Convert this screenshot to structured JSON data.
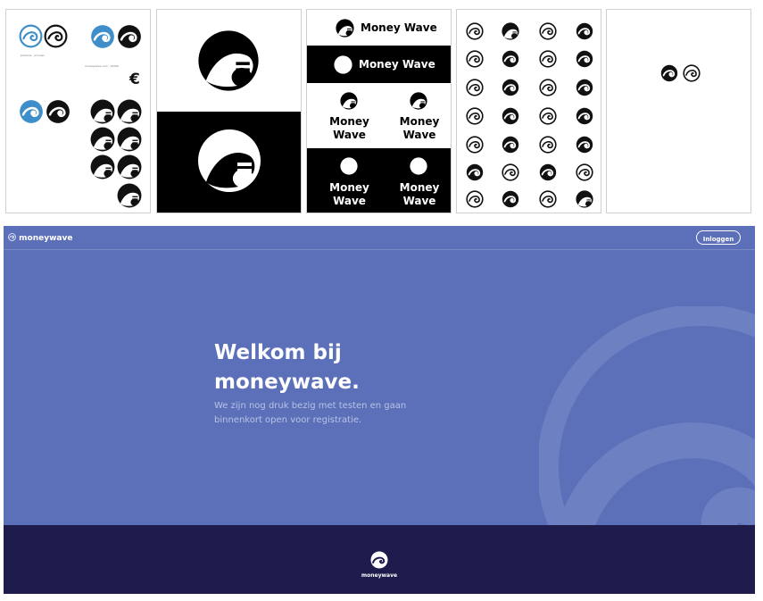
{
  "logo_sheet": {
    "tiny_notes": [
      "pantone · process",
      "moneywave.com · 12345"
    ],
    "euro_symbol": "€"
  },
  "lockups": {
    "brand_name": "Money Wave",
    "brand_name_line1": "Money",
    "brand_name_line2": "Wave"
  },
  "site": {
    "brand": "moneywave",
    "login_label": "Inloggen",
    "hero_title_line1": "Welkom bij",
    "hero_title_line2": "moneywave.",
    "hero_lead": "We zijn nog druk bezig met testen en gaan binnenkort open voor registratie.",
    "footer_brand": "moneywave",
    "colors": {
      "hero": "#5b70b9",
      "footer": "#1d1c4d",
      "accent": "#3d8ec9"
    }
  },
  "icons": [
    "wave-logo-icon",
    "swirl-icon"
  ]
}
